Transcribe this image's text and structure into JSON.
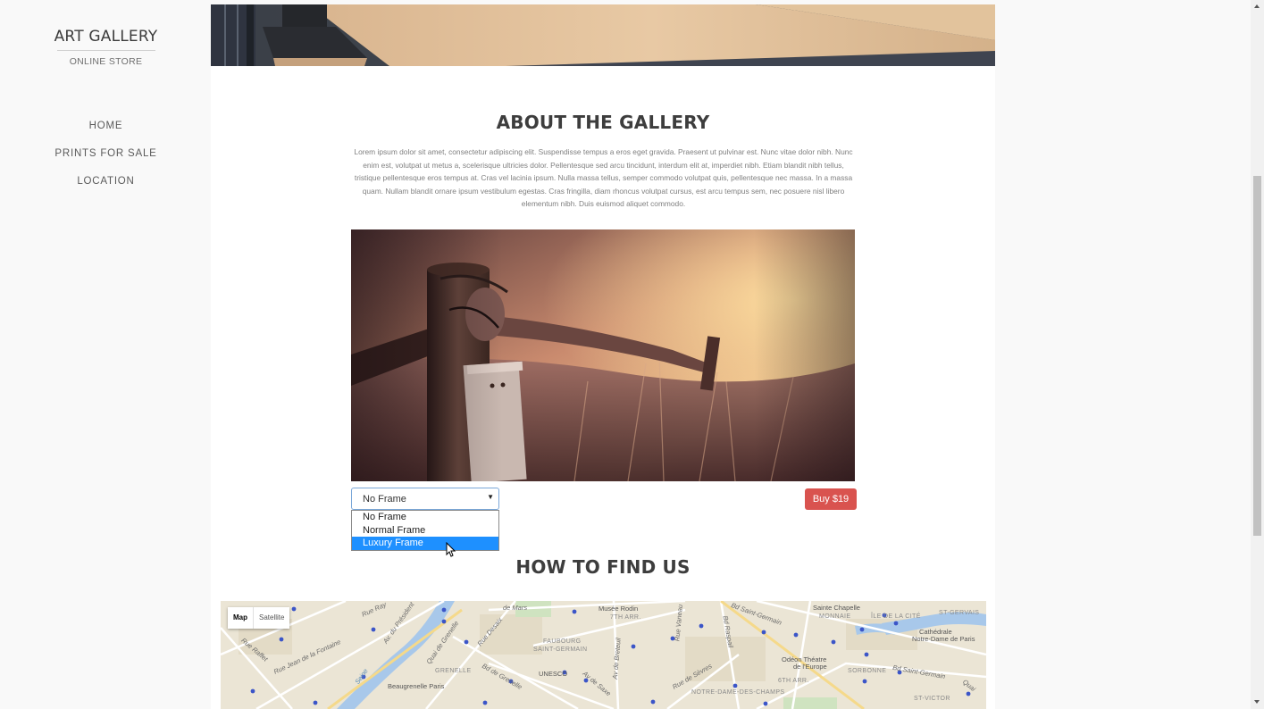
{
  "sidebar": {
    "brand_title": "ART GALLERY",
    "brand_subtitle": "ONLINE STORE",
    "nav": [
      "HOME",
      "PRINTS FOR SALE",
      "LOCATION"
    ]
  },
  "about": {
    "title": "ABOUT THE GALLERY",
    "body": "Lorem ipsum dolor sit amet, consectetur adipiscing elit. Suspendisse tempus a eros eget gravida. Praesent ut pulvinar est. Nunc vitae dolor nibh. Nunc enim est, volutpat ut metus a, scelerisque ultricies dolor. Pellentesque sed arcu tincidunt, interdum elit at, imperdiet nibh. Etiam blandit nibh tellus, tristique pellentesque eros tempus at. Cras vel lacinia ipsum. Nulla massa tellus, semper commodo volutpat quis, pellentesque nec massa. In a massa quam. Nullam blandit ornare ipsum vestibulum egestas. Cras fringilla, diam rhoncus volutpat cursus, est arcu tempus sem, nec posuere nisl libero elementum nibh. Duis euismod aliquet commodo."
  },
  "frame_select": {
    "value": "No Frame",
    "options": [
      "No Frame",
      "Normal Frame",
      "Luxury Frame"
    ],
    "highlighted": "Luxury Frame"
  },
  "buy_button": "Buy $19",
  "find_us": {
    "title": "HOW TO FIND US"
  },
  "map": {
    "map_label": "Map",
    "satellite_label": "Satellite",
    "labels": {
      "de_mars": "de Mars",
      "musee_rodin": "Musée Rodin",
      "arr7": "7TH ARR.",
      "faubourg": "FAUBOURG",
      "saint_germain_dist": "SAINT-GERMAIN",
      "unesco": "UNESCO",
      "grenelle": "GRENELLE",
      "beaugrenelle": "Beaugrenelle Paris",
      "sainte_chapelle": "Sainte Chapelle",
      "monnaie": "MONNAIE",
      "ile_de_la_cite": "ÎLE DE LA CITÉ",
      "st_gervais": "ST-GERVAIS",
      "cathedrale": "Cathédrale",
      "notre_dame": "Notre-Dame de Paris",
      "odeon": "Odéon Théatre",
      "de_leurope": "de l'Europe",
      "sorbonne": "SORBONNE",
      "arr6": "6TH ARR.",
      "notre_dame_des_champs": "NOTRE-DAME-DES-CHAMPS",
      "st_victor": "ST-VICTOR",
      "rue_raffet": "Rue Raffet",
      "rue_jean_fontaine": "Rue Jean de la Fontaine",
      "rue_ray": "Rue Ray",
      "av_president": "Av. du Président",
      "seine": "Seine",
      "quai_grenelle": "Quai de Grenelle",
      "rue_desaix": "Rue Desaix",
      "bd_grenelle": "Bd de Grenelle",
      "av_saxe": "Av de Saxe",
      "av_breteuil": "Av de Breteuil",
      "rue_vaneau": "Rue Vaneau",
      "bd_raspail": "Bd Raspail",
      "rue_sevres": "Rue de Sèvres",
      "bd_st_germain_top": "Bd Saint-Germain",
      "bd_st_germain_right": "Bd Saint-Germain",
      "quai": "Quai"
    }
  },
  "colors": {
    "buy_button_bg": "#d9534f",
    "option_highlight": "#1e90ff",
    "select_border": "#7aa7d9"
  }
}
